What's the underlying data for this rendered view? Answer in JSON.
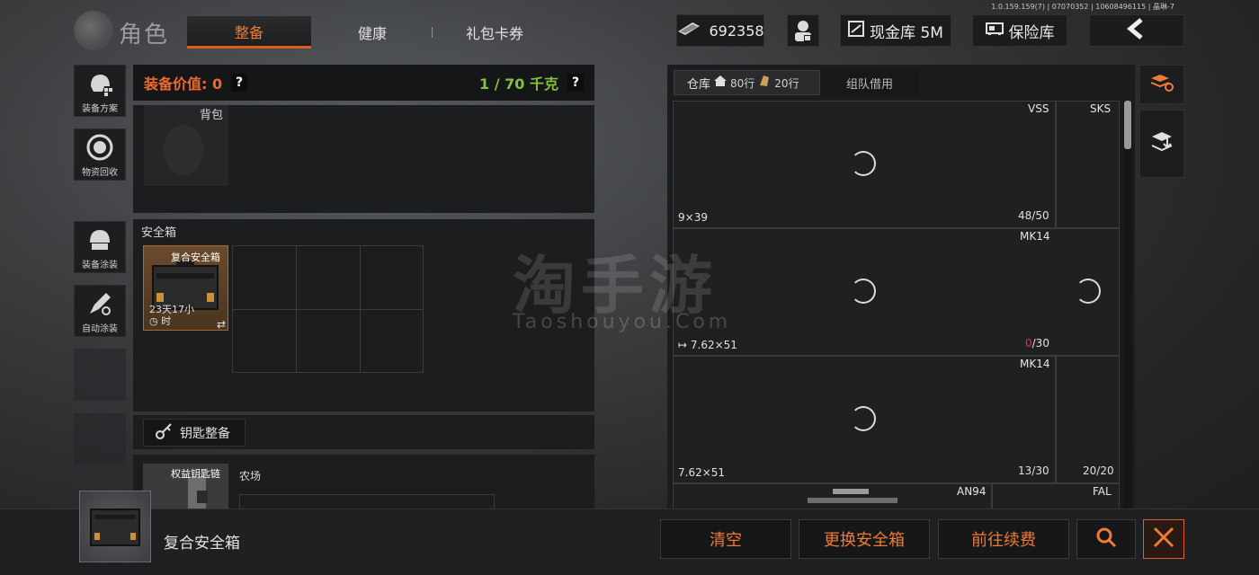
{
  "version": "1.0.159.159(7) | 07070352 | 10608496115 | 晶琳-7",
  "header": {
    "title": "角色",
    "tabs": [
      {
        "label": "整备",
        "active": true
      },
      {
        "label": "健康",
        "active": false
      },
      {
        "label": "礼包卡券",
        "active": false
      }
    ],
    "currency": "692358",
    "cash_vault": "现金库 5M",
    "safe_vault": "保险库"
  },
  "sidebar": [
    {
      "label": "装备方案",
      "icon": "helmet-plan-icon"
    },
    {
      "label": "物资回收",
      "icon": "recycle-icon"
    },
    {
      "label": "装备涂装",
      "icon": "paint-helmet-icon"
    },
    {
      "label": "自动涂装",
      "icon": "auto-paint-icon"
    }
  ],
  "equipment": {
    "value_label": "装备价值: 0",
    "weight": "1 / 70 千克",
    "help": "?",
    "backpack_label": "背包",
    "secure_title": "安全箱",
    "case_name": "复合安全箱",
    "case_time_1": "23天17小",
    "case_time_2": "时",
    "swap": "⇄",
    "key_button": "钥匙整备",
    "key_item": "权益钥匙链",
    "farm": "农场"
  },
  "warehouse": {
    "tab_label": "仓库",
    "rows_80": "80行",
    "rows_20": "20行",
    "team_tab": "组队借用",
    "cells": [
      {
        "name": "VSS",
        "name2": "SKS",
        "ammo": "9×39",
        "count": "48/50"
      },
      {
        "name": "MK14",
        "ammo": "7.62×51",
        "count_zero": "0",
        "count_rest": "/30"
      },
      {
        "name": "MK14",
        "ammo": "7.62×51",
        "count": "13/30",
        "count2": "20/20"
      },
      {
        "name": "AN94",
        "name2": "FAL"
      }
    ]
  },
  "watermark": {
    "cn": "淘手游",
    "en": "Taoshouyou.Com"
  },
  "bottom": {
    "item_name": "复合安全箱",
    "clear": "清空",
    "change_case": "更换安全箱",
    "renew": "前往续费"
  },
  "colors": {
    "accent": "#f07a36",
    "weight": "#85c23c",
    "zero": "#e0304a"
  }
}
